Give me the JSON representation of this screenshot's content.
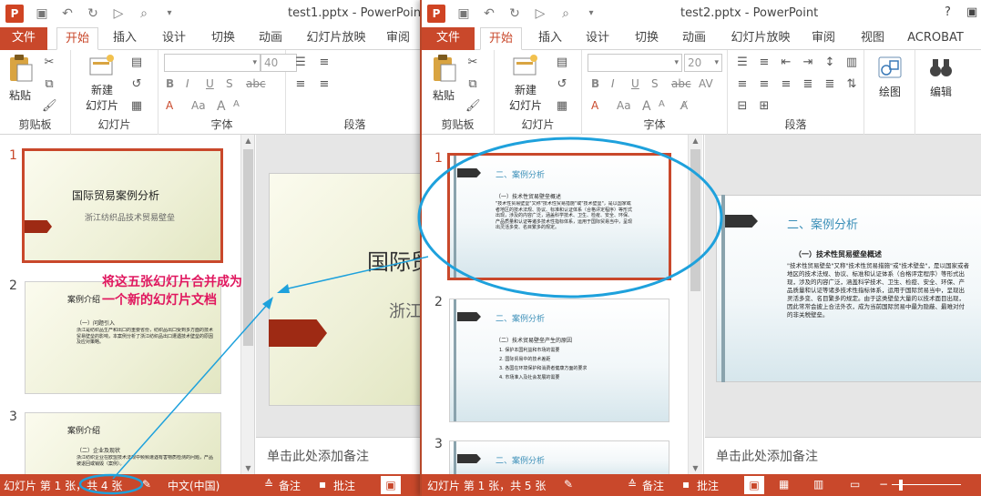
{
  "colors": {
    "accent": "#c9482b",
    "annotation_text": "#e0175e",
    "annotation_line": "#1ea1dc",
    "slide_title_blue": "#3b8fb8"
  },
  "window1": {
    "title": "test1.pptx - PowerPoint",
    "tabs": [
      "文件",
      "开始",
      "插入",
      "设计",
      "切换",
      "动画",
      "幻灯片放映",
      "审阅"
    ],
    "ribbon": {
      "clipboard": {
        "label": "剪贴板",
        "paste": "粘贴"
      },
      "slides": {
        "label": "幻灯片",
        "new_slide_1": "新建",
        "new_slide_2": "幻灯片"
      },
      "font": {
        "label": "字体",
        "size": "40"
      },
      "paragraph": {
        "label": "段落"
      }
    },
    "thumbnails": [
      {
        "num": "1",
        "title": "国际贸易案例分析",
        "subtitle": "浙江纺织品技术贸易壁垒"
      },
      {
        "num": "2",
        "title": "案例介绍",
        "heading": "（一）问题引入",
        "body": "浙江是纺织品生产和出口的重要省份，纺织品出口受到多方面的技术贸易壁垒的影响，本案例分析了浙江纺织品出口遭遇技术壁垒的原因及应对策略。"
      },
      {
        "num": "3",
        "title": "案例介绍",
        "heading": "（二）企业及现状",
        "body": "浙江纺织企业在欧盟技术法规中频频遭遇有害物质检测的问题，产品被退回或销毁（案例）。"
      }
    ],
    "main_slide": {
      "title": "国际贸",
      "subtitle": "浙江"
    },
    "notes": "单击此处添加备注",
    "status": {
      "slide_info": "幻灯片 第 1 张，共 4 张",
      "language": "中文(中国)",
      "notes": "备注",
      "comments": "批注"
    }
  },
  "window2": {
    "title": "test2.pptx - PowerPoint",
    "help": "?",
    "tabs": [
      "文件",
      "开始",
      "插入",
      "设计",
      "切换",
      "动画",
      "幻灯片放映",
      "审阅",
      "视图",
      "ACROBAT"
    ],
    "ribbon": {
      "clipboard": {
        "label": "剪贴板",
        "paste": "粘贴"
      },
      "slides": {
        "label": "幻灯片",
        "new_slide_1": "新建",
        "new_slide_2": "幻灯片"
      },
      "font": {
        "label": "字体",
        "size": "20"
      },
      "paragraph": {
        "label": "段落"
      },
      "drawing": "绘图",
      "editing": "编辑"
    },
    "thumbnails": [
      {
        "num": "1",
        "title": "二、案例分析",
        "heading": "（一）技术性贸易壁垒概述",
        "body": "\"技术性贸易壁垒\"又称\"技术性贸易措施\"或\"技术壁垒\"，是以国家或者地区的技术法规、协议、标准和认证体系（合格评定程序）等形式出现，涉及的内容广泛，涵盖科学技术、卫生、检疫、安全、环保、产品质量和认证等诸多技术性指标体系，运用于国际贸易当中，呈现出灵活多变、名目繁多的规定。"
      },
      {
        "num": "2",
        "title": "二、案例分析",
        "heading": "（二）技术贸易壁垒产生的原因",
        "items": [
          "1. 保护本国利益和市场的需要",
          "2. 国际贸易中的技术差距",
          "3. 各国在环境保护和消费者健康方面的要求",
          "4. 市场准入及社会发展的需要"
        ]
      },
      {
        "num": "3",
        "title": "二、案例分析"
      }
    ],
    "main_slide": {
      "title": "二、案例分析",
      "heading": "（一）技术性贸易壁垒概述",
      "body": "\"技术性贸易壁垒\"又称\"技术性贸易措施\"或\"技术壁垒\"，是以国家或者地区的技术法规、协议、标准和认证体系（合格评定程序）等形式出现，涉及的内容广泛，涵盖科学技术、卫生、检疫、安全、环保、产品质量和认证等诸多技术性指标体系，运用于国际贸易当中，呈现出灵活多变、名目繁多的规定。由于这类壁垒大量的以技术面目出现，因此常常会披上合法外衣，成为当前国际贸易中最为隐蔽、最难对付的非关税壁垒。"
    },
    "notes": "单击此处添加备注",
    "status": {
      "slide_info": "幻灯片 第 1 张，共 5 张",
      "notes": "备注",
      "comments": "批注"
    }
  },
  "annotation": {
    "line1": "将这五张幻灯片合并成为",
    "line2": "一个新的幻灯片文档"
  }
}
